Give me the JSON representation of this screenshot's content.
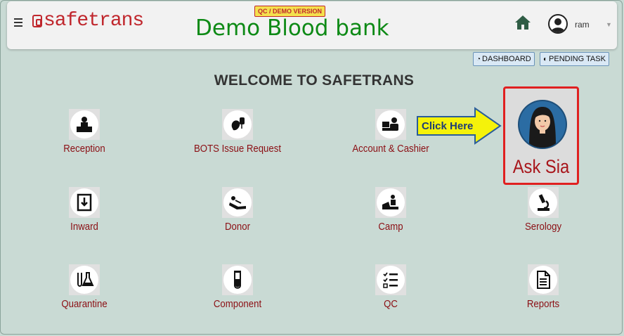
{
  "header": {
    "logo_text": "safetrans",
    "demo_badge": "QC / DEMO VERSION",
    "title": "Demo Blood bank",
    "user_name": "ram",
    "user_caret": "▼"
  },
  "toolbar": {
    "dashboard_label": "DASHBOARD",
    "pending_task_label": "PENDING TASK"
  },
  "welcome": "WELCOME TO SAFETRANS",
  "callout": {
    "text": "Click Here"
  },
  "ask_sia": {
    "label": "Ask Sia"
  },
  "tiles": [
    {
      "label": "Reception",
      "icon": "reception-icon"
    },
    {
      "label": "BOTS Issue Request",
      "icon": "blood-bag-icon"
    },
    {
      "label": "Account & Cashier",
      "icon": "cashier-icon"
    },
    {
      "label": "Inward",
      "icon": "inward-icon"
    },
    {
      "label": "Donor",
      "icon": "donor-icon"
    },
    {
      "label": "Camp",
      "icon": "camp-icon"
    },
    {
      "label": "Serology",
      "icon": "microscope-icon"
    },
    {
      "label": "Quarantine",
      "icon": "flask-icon"
    },
    {
      "label": "Component",
      "icon": "test-tube-icon"
    },
    {
      "label": "QC",
      "icon": "checklist-icon"
    },
    {
      "label": "Reports",
      "icon": "document-icon"
    }
  ],
  "colors": {
    "background": "#c9dad4",
    "brand_red": "#c0272d",
    "title_green": "#0e8a16",
    "tile_label": "#8b0f14",
    "callout_yellow": "#f5f20a"
  }
}
